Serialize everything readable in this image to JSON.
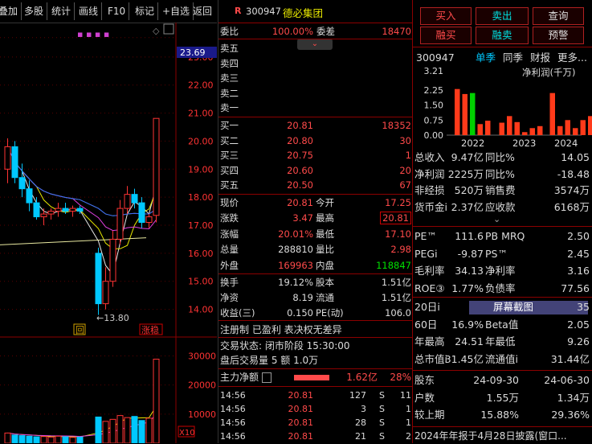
{
  "toolbar": {
    "items": [
      "叠加",
      "多股",
      "统计",
      "画线",
      "F10",
      "标记",
      "+自选",
      "返回"
    ]
  },
  "chart": {
    "price_labels": [
      "23.69",
      "23.00",
      "22.00",
      "21.00",
      "20.00",
      "19.00",
      "18.00",
      "17.00",
      "16.00",
      "15.00",
      "14.00"
    ],
    "low_label": "←13.80",
    "hui_label": "回",
    "zhangting_label": "涨稳",
    "vol_labels": [
      "30000",
      "20000",
      "10000"
    ],
    "vol_unit": "X10"
  },
  "chart_data": {
    "type": "candlestick",
    "ylim": [
      13.5,
      24.0
    ],
    "candles": [
      {
        "o": 19.0,
        "h": 20.1,
        "l": 18.5,
        "c": 19.8
      },
      {
        "o": 19.8,
        "h": 20.0,
        "l": 18.5,
        "c": 18.7
      },
      {
        "o": 18.7,
        "h": 19.2,
        "l": 18.0,
        "c": 18.3
      },
      {
        "o": 18.3,
        "h": 18.6,
        "l": 17.5,
        "c": 17.8
      },
      {
        "o": 17.8,
        "h": 18.0,
        "l": 17.2,
        "c": 17.3
      },
      {
        "o": 17.3,
        "h": 17.6,
        "l": 17.0,
        "c": 17.4
      },
      {
        "o": 17.4,
        "h": 17.6,
        "l": 17.2,
        "c": 17.5
      },
      {
        "o": 17.5,
        "h": 17.8,
        "l": 17.3,
        "c": 17.6
      },
      {
        "o": 17.6,
        "h": 17.8,
        "l": 17.4,
        "c": 17.5
      },
      {
        "o": 17.5,
        "h": 17.7,
        "l": 17.3,
        "c": 17.6
      },
      {
        "o": 17.6,
        "h": 17.7,
        "l": 17.4,
        "c": 17.5
      },
      {
        "o": 16.0,
        "h": 16.2,
        "l": 13.8,
        "c": 14.2
      },
      {
        "o": 14.2,
        "h": 15.5,
        "l": 14.0,
        "c": 15.0
      },
      {
        "o": 15.0,
        "h": 16.8,
        "l": 14.8,
        "c": 16.5
      },
      {
        "o": 16.5,
        "h": 17.9,
        "l": 16.3,
        "c": 17.6
      },
      {
        "o": 17.6,
        "h": 18.4,
        "l": 17.4,
        "c": 18.1
      },
      {
        "o": 18.1,
        "h": 18.3,
        "l": 17.6,
        "c": 17.8
      },
      {
        "o": 17.8,
        "h": 18.0,
        "l": 16.9,
        "c": 17.1
      },
      {
        "o": 17.1,
        "h": 17.4,
        "l": 16.9,
        "c": 17.3
      },
      {
        "o": 17.35,
        "h": 20.81,
        "l": 17.1,
        "c": 20.81
      }
    ]
  },
  "quote": {
    "code": "300947",
    "name": "德必集团",
    "r_mark": "R",
    "weibi_label": "委比",
    "weibi_value": "100.00%",
    "weicha_label": "委差",
    "weicha_value": "18470",
    "sell": [
      {
        "label": "卖五"
      },
      {
        "label": "卖四"
      },
      {
        "label": "卖三"
      },
      {
        "label": "卖二"
      },
      {
        "label": "卖一"
      }
    ],
    "buy": [
      {
        "label": "买一",
        "price": "20.81",
        "vol": "18352"
      },
      {
        "label": "买二",
        "price": "20.80",
        "vol": "30"
      },
      {
        "label": "买三",
        "price": "20.75",
        "vol": "1"
      },
      {
        "label": "买四",
        "price": "20.60",
        "vol": "20"
      },
      {
        "label": "买五",
        "price": "20.50",
        "vol": "67"
      }
    ],
    "stats": [
      {
        "l1": "现价",
        "v1": "20.81",
        "c1": "red",
        "l2": "今开",
        "v2": "17.25",
        "c2": "red"
      },
      {
        "l1": "涨跌",
        "v1": "3.47",
        "c1": "red",
        "l2": "最高",
        "v2": "20.81",
        "c2": "red"
      },
      {
        "l1": "涨幅",
        "v1": "20.01%",
        "c1": "red",
        "l2": "最低",
        "v2": "17.10",
        "c2": "red"
      },
      {
        "l1": "总量",
        "v1": "288810",
        "c1": "wht",
        "l2": "量比",
        "v2": "2.98",
        "c2": "red"
      },
      {
        "l1": "外盘",
        "v1": "169963",
        "c1": "red",
        "l2": "内盘",
        "v2": "118847",
        "c2": "grn"
      }
    ],
    "stats2": [
      {
        "l1": "换手",
        "v1": "19.12%",
        "l2": "股本",
        "v2": "1.51亿"
      },
      {
        "l1": "净资",
        "v1": "8.19",
        "l2": "流通",
        "v2": "1.51亿"
      },
      {
        "l1": "收益(三)",
        "v1": "0.150",
        "l2": "PE(动)",
        "v2": "106.0"
      }
    ],
    "regtext": "注册制 已盈利 表决权无差异",
    "trade_state": "交易状态: 闭市阶段 15:30:00",
    "after_hours": "盘后交易量 5 额 1.0万",
    "main_flow_label": "主力净额",
    "main_flow_value": "1.62亿",
    "main_flow_pct": "28%",
    "ticks": [
      {
        "time": "14:56",
        "price": "20.81",
        "vol": "127",
        "side": "S",
        "n": "11"
      },
      {
        "time": "14:56",
        "price": "20.81",
        "vol": "3",
        "side": "S",
        "n": "1"
      },
      {
        "time": "14:56",
        "price": "20.81",
        "vol": "28",
        "side": "S",
        "n": "1"
      },
      {
        "time": "14:56",
        "price": "20.81",
        "vol": "21",
        "side": "S",
        "n": "2"
      }
    ]
  },
  "info": {
    "buttons": [
      "买入",
      "卖出",
      "查询",
      "融买",
      "融卖",
      "预警"
    ],
    "code": "300947",
    "tabs": [
      "单季",
      "同季",
      "财报",
      "更多..."
    ],
    "bar_chart": {
      "title": "净利润(千万)",
      "yticks": [
        "3.21",
        "2.25",
        "1.50",
        "0.75",
        "0.00"
      ],
      "years": [
        "2022",
        "2023",
        "2024"
      ],
      "values": [
        2.3,
        2.05,
        2.1,
        0.55,
        0.72,
        0.62,
        0.95,
        0.65,
        0.15,
        0.35,
        0.45,
        2.1,
        0.45,
        0.75,
        0.35,
        0.75,
        0.95
      ],
      "highlight_value": 3.21
    },
    "fin_rows": [
      {
        "l1": "总收入",
        "v1": "9.47亿",
        "l2": "同比%",
        "v2": "14.05"
      },
      {
        "l1": "净利润",
        "v1": "2225万",
        "l2": "同比%",
        "v2": "-18.48"
      },
      {
        "l1": "非经损",
        "v1": "520万",
        "l2": "销售费",
        "v2": "3574万"
      },
      {
        "l1": "货币金i",
        "v1": "2.37亿",
        "l2": "应收款",
        "v2": "6168万"
      }
    ],
    "val_rows": [
      {
        "l1": "PE™",
        "v1": "111.6",
        "l2": "PB MRQ",
        "v2": "2.50"
      },
      {
        "l1": "PEGi",
        "v1": "-9.87",
        "l2": "PS™",
        "v2": "2.45"
      },
      {
        "l1": "毛利率",
        "v1": "34.13",
        "l2": "净利率",
        "v2": "3.16"
      },
      {
        "l1": "ROE③",
        "v1": "1.77%",
        "l2": "负债率",
        "v2": "77.56"
      }
    ],
    "perf_rows": [
      {
        "l1": "20日i",
        "v1": "",
        "l2": "屏幕截图",
        "v2": "35"
      },
      {
        "l1": "60日",
        "v1": "16.9%",
        "l2": "Beta值",
        "v2": "2.05"
      },
      {
        "l1": "年最高",
        "v1": "24.51",
        "l2": "年最低",
        "v2": "9.26"
      },
      {
        "l1": "总市值i",
        "v1": "31.45亿",
        "l2": "流通值i",
        "v2": "31.44亿"
      }
    ],
    "holder_rows": [
      {
        "l1": "股东",
        "v1": "24-09-30",
        "v2": "24-06-30"
      },
      {
        "l1": "户数",
        "v1": "1.55万",
        "v2": "1.34万"
      },
      {
        "l1": "较上期",
        "v1": "15.88%",
        "v2": "29.36%"
      }
    ],
    "footer": "2024年年报于4月28日披露(窗口..."
  },
  "colors": {
    "up": "#ff3333",
    "down": "#00c8ff",
    "grid": "#8b0000",
    "label": "#ff3333"
  }
}
